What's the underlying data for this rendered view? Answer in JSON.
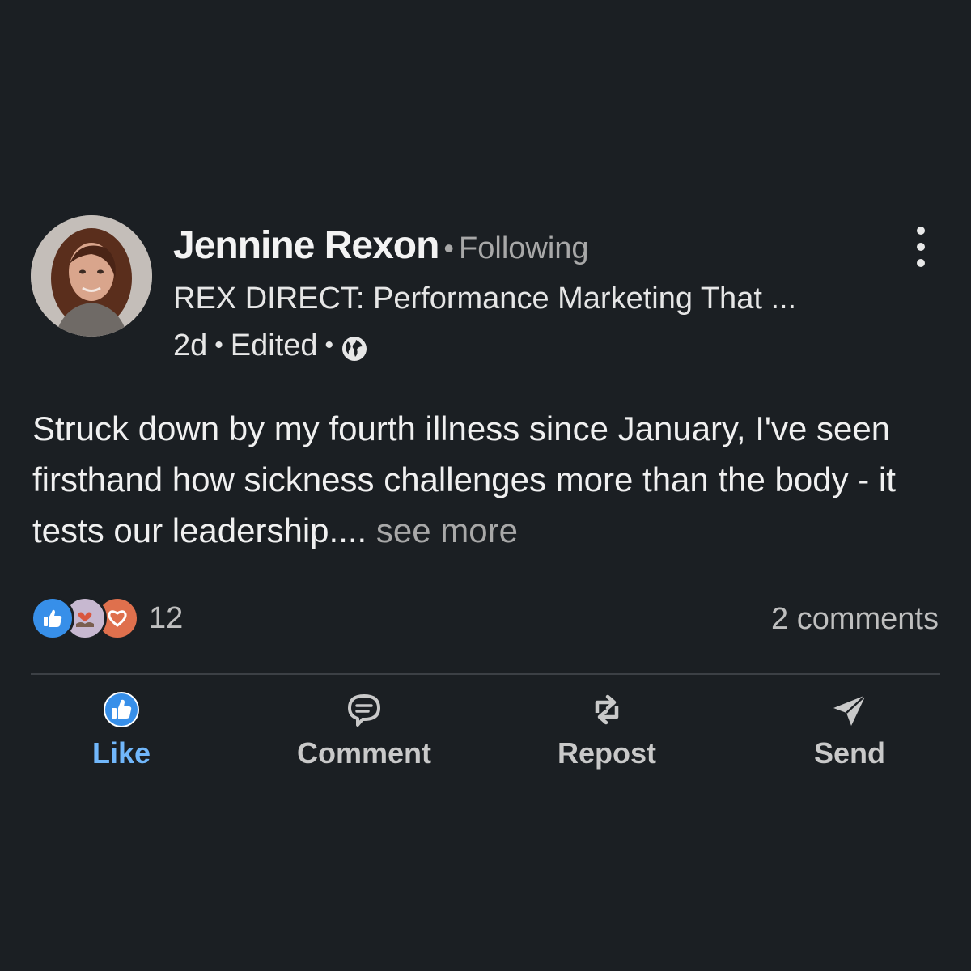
{
  "post": {
    "author": {
      "name": "Jennine Rexon",
      "follow_status": "Following",
      "headline": "REX DIRECT: Performance Marketing That ...",
      "avatar_icon": "profile-photo"
    },
    "meta": {
      "age": "2d",
      "edited_label": "Edited",
      "visibility_icon": "globe-icon"
    },
    "text": "Struck down by my fourth illness since January, I've seen firsthand how sickness challenges more than the body - it tests our leadership....",
    "see_more_label": "see more",
    "reactions": {
      "icons": [
        "like-icon",
        "support-icon",
        "love-icon"
      ],
      "count": "12"
    },
    "comments_label": "2 comments"
  },
  "actions": {
    "like_label": "Like",
    "comment_label": "Comment",
    "repost_label": "Repost",
    "send_label": "Send"
  },
  "colors": {
    "background": "#1b1f23",
    "accent_blue": "#71b7fb",
    "like_blue": "#378fe9",
    "love_orange": "#df704d",
    "muted_text": "#a8a8a8"
  }
}
